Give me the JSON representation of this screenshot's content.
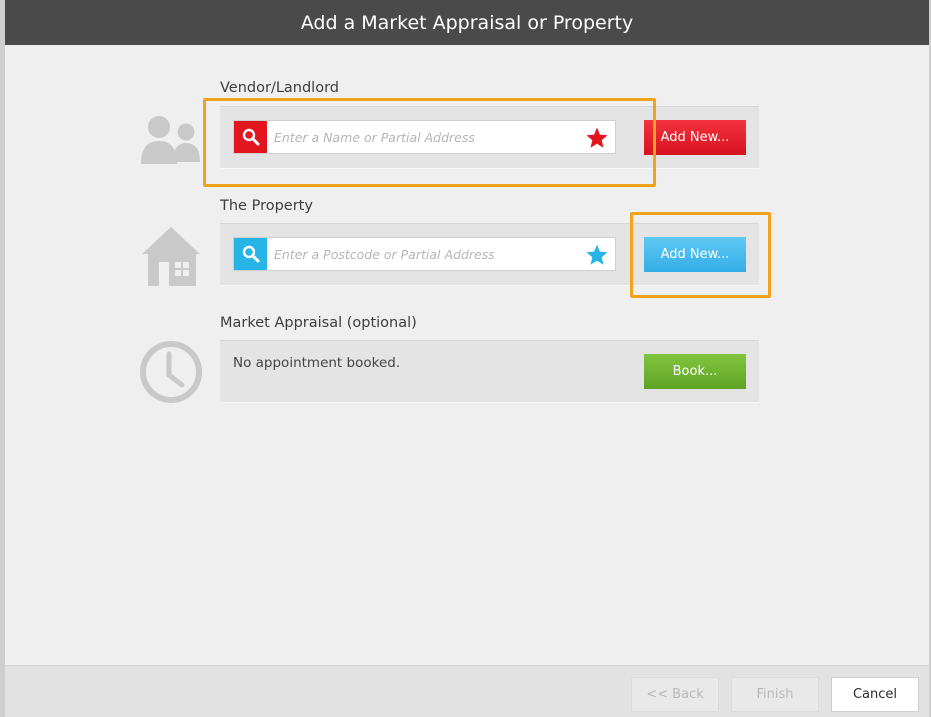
{
  "dialog": {
    "title": "Add a Market Appraisal or Property"
  },
  "vendor": {
    "label": "Vendor/Landlord",
    "icon": "people-icon",
    "search_placeholder": "Enter a Name or Partial Address",
    "add_label": "Add New...",
    "accent": "#e3161f"
  },
  "property": {
    "label": "The Property",
    "icon": "house-icon",
    "search_placeholder": "Enter a Postcode or Partial Address",
    "add_label": "Add New...",
    "accent": "#29b4e8"
  },
  "appraisal": {
    "label": "Market Appraisal (optional)",
    "icon": "clock-icon",
    "status": "No appointment booked.",
    "book_label": "Book..."
  },
  "footer": {
    "back_label": "<< Back",
    "finish_label": "Finish",
    "cancel_label": "Cancel"
  },
  "highlight_color": "#f2a21c"
}
